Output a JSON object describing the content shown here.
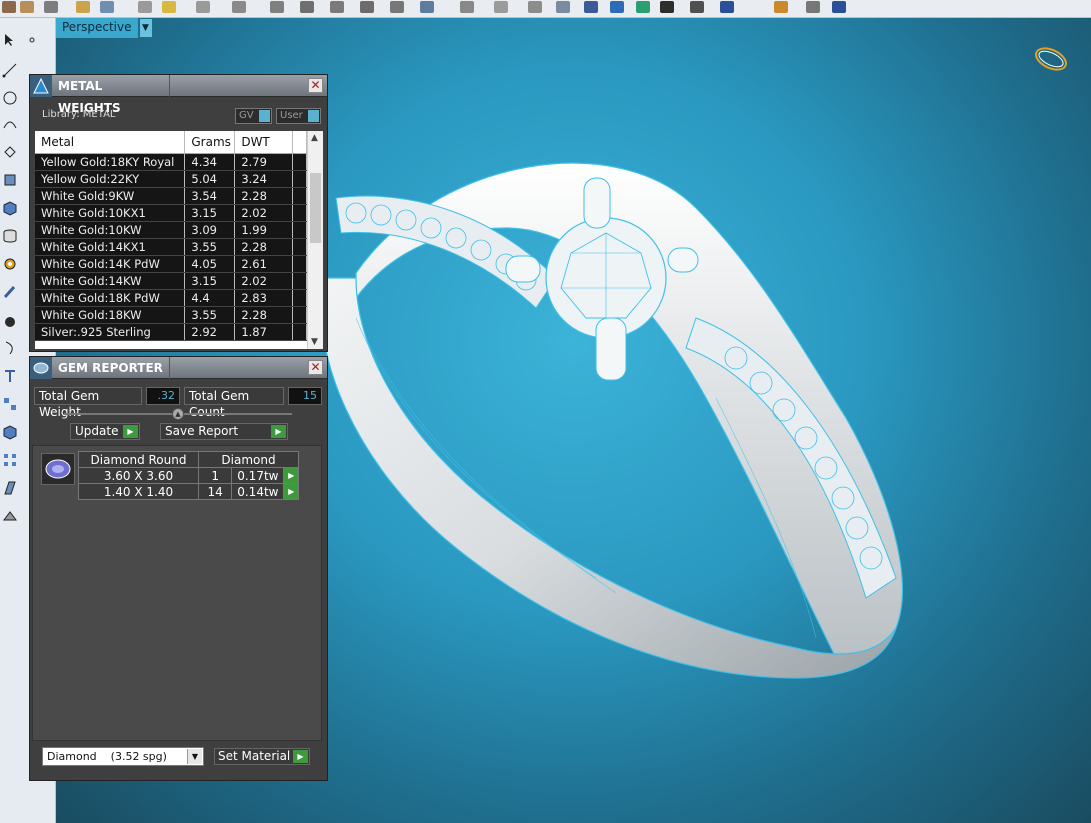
{
  "viewport": {
    "tab_label": "Perspective",
    "dropdown_icon": "chevron-down-icon"
  },
  "metal_panel": {
    "title": "METAL WEIGHTS",
    "library_label": "Library:",
    "library_value": "METAL",
    "toggle_gv": "GV",
    "toggle_user": "User",
    "columns": [
      "Metal",
      "Grams",
      "DWT"
    ],
    "rows": [
      [
        "Yellow Gold:18KY Royal",
        "4.34",
        "2.79"
      ],
      [
        "Yellow Gold:22KY",
        "5.04",
        "3.24"
      ],
      [
        "White Gold:9KW",
        "3.54",
        "2.28"
      ],
      [
        "White Gold:10KX1",
        "3.15",
        "2.02"
      ],
      [
        "White Gold:10KW",
        "3.09",
        "1.99"
      ],
      [
        "White Gold:14KX1",
        "3.55",
        "2.28"
      ],
      [
        "White Gold:14K PdW",
        "4.05",
        "2.61"
      ],
      [
        "White Gold:14KW",
        "3.15",
        "2.02"
      ],
      [
        "White Gold:18K PdW",
        "4.4",
        "2.83"
      ],
      [
        "White Gold:18KW",
        "3.55",
        "2.28"
      ],
      [
        "Silver:.925 Sterling",
        "2.92",
        "1.87"
      ]
    ]
  },
  "gem_panel": {
    "title": "GEM REPORTER",
    "total_weight_label": "Total Gem Weight",
    "total_weight_value": ".32",
    "total_count_label": "Total Gem Count",
    "total_count_value": "15",
    "update_label": "Update",
    "save_report_label": "Save Report",
    "table_headers": [
      "Diamond Round",
      "Diamond"
    ],
    "table_rows": [
      [
        "3.60 X 3.60",
        "1",
        "0.17tw"
      ],
      [
        "1.40 X 1.40",
        "14",
        "0.14tw"
      ]
    ],
    "material_select": "Diamond    (3.52 spg)",
    "set_material_label": "Set Material"
  },
  "colors": {
    "accent": "#5ab2d0",
    "go_green": "#3d9a3d",
    "viewport_blue": "#2a98c0"
  }
}
